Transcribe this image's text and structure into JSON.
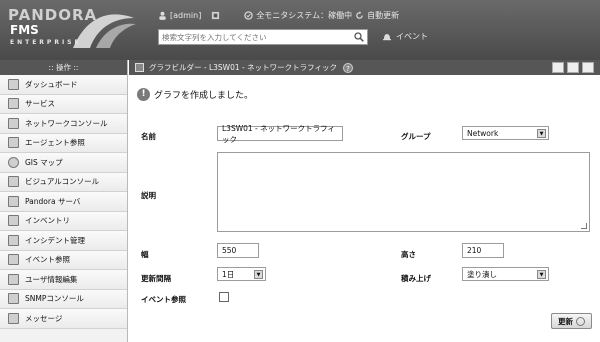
{
  "header": {
    "logo_line1": "PANDORA",
    "logo_line2": "FMS",
    "logo_line3": "ENTERPRISE",
    "user": "[admin]",
    "all_systems": "全モニタシステム：稼働中",
    "auto_refresh": "自動更新",
    "search_placeholder": "検索文字列を入力してください",
    "event_link": "イベント"
  },
  "sidebar": {
    "heading": ":: 操作 ::",
    "items": [
      {
        "label": "ダッシュボード",
        "icon": "dashboard-icon"
      },
      {
        "label": "サービス",
        "icon": "services-icon"
      },
      {
        "label": "ネットワークコンソール",
        "icon": "network-console-icon"
      },
      {
        "label": "エージェント参照",
        "icon": "agent-icon"
      },
      {
        "label": "GIS マップ",
        "icon": "gis-map-icon"
      },
      {
        "label": "ビジュアルコンソール",
        "icon": "visual-console-icon"
      },
      {
        "label": "Pandora サーバ",
        "icon": "server-icon"
      },
      {
        "label": "インベントリ",
        "icon": "inventory-icon"
      },
      {
        "label": "インシデント管理",
        "icon": "incident-icon"
      },
      {
        "label": "イベント参照",
        "icon": "event-icon"
      },
      {
        "label": "ユーザ情報編集",
        "icon": "user-edit-icon"
      },
      {
        "label": "SNMPコンソール",
        "icon": "snmp-icon"
      },
      {
        "label": "メッセージ",
        "icon": "message-icon"
      }
    ]
  },
  "main": {
    "title": "グラフビルダー - L3SW01 - ネットワークトラフィック",
    "success_message": "グラフを作成しました。",
    "form": {
      "name_label": "名前",
      "name_value": "L3SW01 - ネットワークトラフィック",
      "group_label": "グループ",
      "group_value": "Network",
      "description_label": "説明",
      "width_label": "幅",
      "width_value": "550",
      "height_label": "高さ",
      "height_value": "210",
      "period_label": "更新間隔",
      "period_value": "1日",
      "stacked_label": "積み上げ",
      "stacked_value": "塗り潰し",
      "events_label": "イベント参照"
    },
    "update_button": "更新"
  }
}
